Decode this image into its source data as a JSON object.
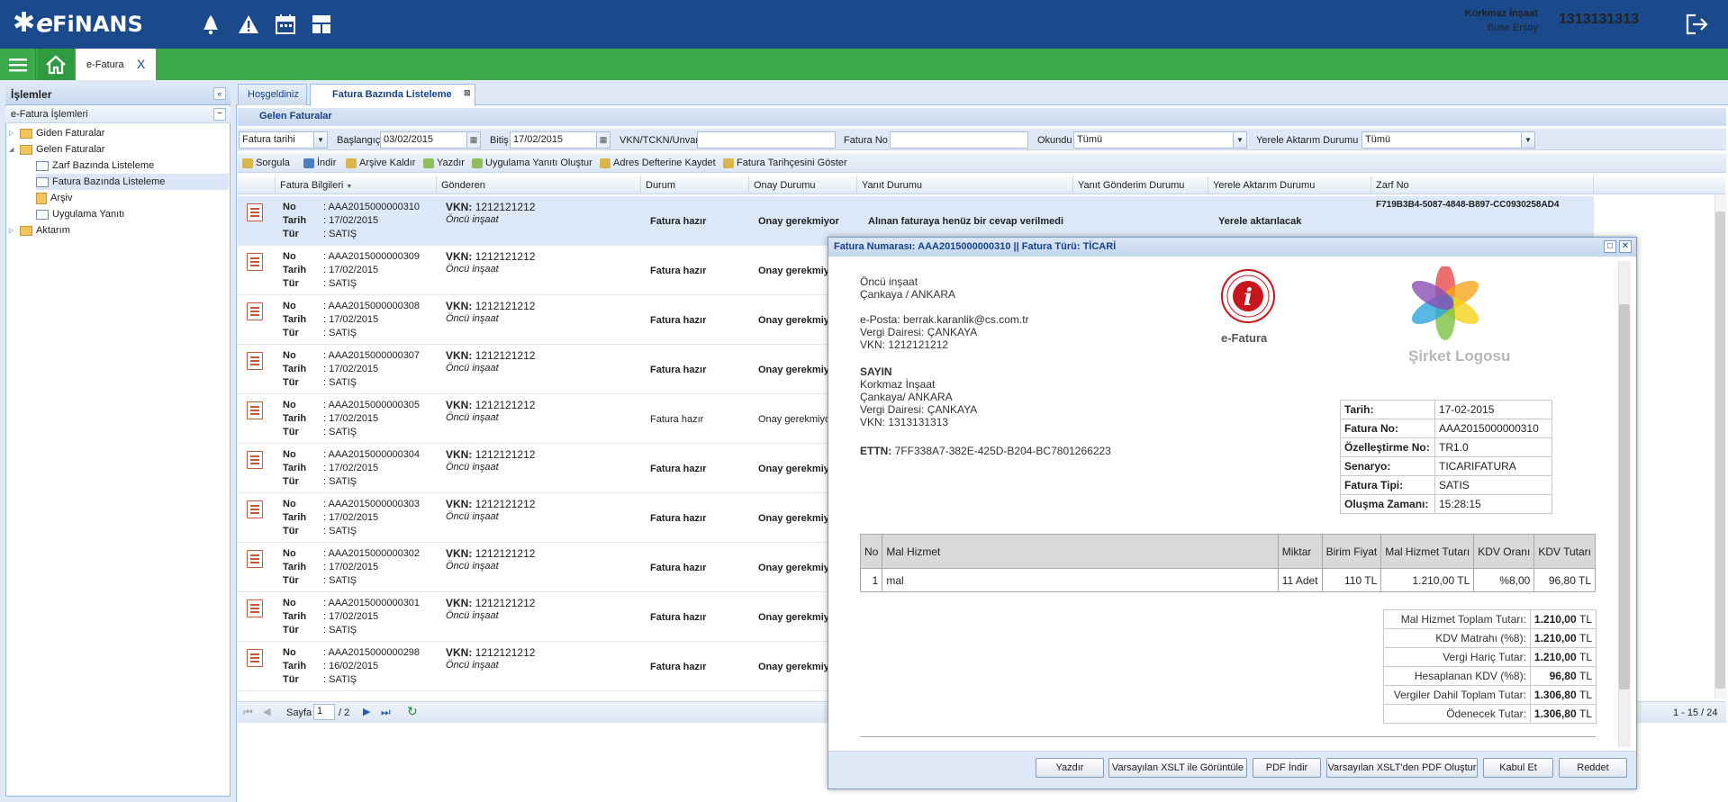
{
  "header": {
    "logo": {
      "star": "✱",
      "e": "e",
      "fin": "FiNANS"
    },
    "icons": [
      "bell-icon",
      "warning-icon",
      "calendar-icon",
      "dashboard-icon"
    ],
    "user_company": "Korkmaz İnşaat",
    "user_name": "Buse Ersoy",
    "user_vkn": "1313131313"
  },
  "nav": {
    "module_tab": "e-Fatura",
    "close_glyph": "X"
  },
  "left_panel": {
    "title": "İşlemler",
    "subtitle": "e-Fatura İşlemleri",
    "items": [
      {
        "label": "Giden Faturalar"
      },
      {
        "label": "Gelen Faturalar"
      },
      {
        "label": "Zarf Bazında Listeleme"
      },
      {
        "label": "Fatura Bazında Listeleme"
      },
      {
        "label": "Arşiv"
      },
      {
        "label": "Uygulama Yanıtı"
      },
      {
        "label": "Aktarım"
      }
    ]
  },
  "tabs": [
    {
      "label": "Hoşgeldiniz"
    },
    {
      "label": "Fatura Bazında Listeleme"
    }
  ],
  "section_title": "Gelen Faturalar",
  "filters": {
    "date_type": "Fatura tarihi",
    "start_label": "Başlangıç",
    "start_value": "03/02/2015",
    "end_label": "Bitiş",
    "end_value": "17/02/2015",
    "vkn_label": "VKN/TCKN/Unvan",
    "vkn_value": "",
    "fatura_no_label": "Fatura No",
    "fatura_no_value": "",
    "okundu_label": "Okundu",
    "okundu_value": "Tümü",
    "aktarim_label": "Yerele Aktarım Durumu",
    "aktarim_value": "Tümü"
  },
  "toolbar": {
    "sorgula": "Sorgula",
    "indir": "İndir",
    "arsive_kaldir": "Arşive Kaldır",
    "yazdir": "Yazdır",
    "uygulama_yaniti": "Uygulama Yanıtı Oluştur",
    "adres_defteri": "Adres Defterine Kaydet",
    "fatura_tarihcesi": "Fatura Tarihçesini Göster"
  },
  "grid": {
    "columns": [
      "Fatura Bilgileri",
      "Gönderen",
      "Durum",
      "Onay Durumu",
      "Yanıt Durumu",
      "Yanıt Gönderim Durumu",
      "Yerele Aktarım Durumu",
      "Zarf No"
    ],
    "key_no": "No",
    "key_tarih": "Tarih",
    "key_tur": "Tür",
    "vkn_key": "VKN:",
    "rows": [
      {
        "no": ": AAA2015000000310",
        "tarih": ": 17/02/2015",
        "tur": ": SATIŞ",
        "vkn": "1212121212",
        "sender": "Öncü inşaat",
        "durum": "Fatura hazır",
        "onay": "Onay gerekmiyor",
        "yanit": "Alınan faturaya henüz bir cevap verilmedi",
        "aktarim": "Yerele aktarılacak",
        "zarf": "F719B3B4-5087-4848-B897-CC0930258AD4"
      },
      {
        "no": ": AAA2015000000309",
        "tarih": ": 17/02/2015",
        "tur": ": SATIŞ",
        "vkn": "1212121212",
        "sender": "Öncü inşaat",
        "durum": "Fatura hazır",
        "onay": "Onay gerekmiy"
      },
      {
        "no": ": AAA2015000000308",
        "tarih": ": 17/02/2015",
        "tur": ": SATIŞ",
        "vkn": "1212121212",
        "sender": "Öncü inşaat",
        "durum": "Fatura hazır",
        "onay": "Onay gerekmiy"
      },
      {
        "no": ": AAA2015000000307",
        "tarih": ": 17/02/2015",
        "tur": ": SATIŞ",
        "vkn": "1212121212",
        "sender": "Öncü inşaat",
        "durum": "Fatura hazır",
        "onay": "Onay gerekmiy"
      },
      {
        "no": ": AAA2015000000305",
        "tarih": ": 17/02/2015",
        "tur": ": SATIŞ",
        "vkn": "1212121212",
        "sender": "Öncü inşaat",
        "durum": "Fatura hazır",
        "onay": "Onay gerekmiyo"
      },
      {
        "no": ": AAA2015000000304",
        "tarih": ": 17/02/2015",
        "tur": ": SATIŞ",
        "vkn": "1212121212",
        "sender": "Öncü inşaat",
        "durum": "Fatura hazır",
        "onay": "Onay gerekmiy"
      },
      {
        "no": ": AAA2015000000303",
        "tarih": ": 17/02/2015",
        "tur": ": SATIŞ",
        "vkn": "1212121212",
        "sender": "Öncü inşaat",
        "durum": "Fatura hazır",
        "onay": "Onay gerekmiy"
      },
      {
        "no": ": AAA2015000000302",
        "tarih": ": 17/02/2015",
        "tur": ": SATIŞ",
        "vkn": "1212121212",
        "sender": "Öncü inşaat",
        "durum": "Fatura hazır",
        "onay": "Onay gerekmiy"
      },
      {
        "no": ": AAA2015000000301",
        "tarih": ": 17/02/2015",
        "tur": ": SATIŞ",
        "vkn": "1212121212",
        "sender": "Öncü inşaat",
        "durum": "Fatura hazır",
        "onay": "Onay gerekmiy"
      },
      {
        "no": ": AAA2015000000298",
        "tarih": ": 16/02/2015",
        "tur": ": SATIŞ",
        "vkn": "1212121212",
        "sender": "Öncü inşaat",
        "durum": "Fatura hazır",
        "onay": "Onay gerekmiy"
      }
    ]
  },
  "pager": {
    "page_label": "Sayfa",
    "page_value": "1",
    "page_total": "/ 2",
    "range": "1 - 15 / 24"
  },
  "modal": {
    "title": "Fatura Numarası: AAA2015000000310 || Fatura Türü: TİCARİ",
    "seller": {
      "name": "Öncü inşaat",
      "address": "Çankaya / ANKARA",
      "email": "e-Posta: berrak.karanlik@cs.com.tr",
      "tax_office": "Vergi Dairesi: ÇANKAYA",
      "vkn": "VKN: 1212121212"
    },
    "buyer": {
      "heading": "SAYIN",
      "name": "Korkmaz İnşaat",
      "address": "Çankaya/ ANKARA",
      "tax_office": "Vergi Dairesi: ÇANKAYA",
      "vkn": "VKN: 1313131313"
    },
    "ettn_label": "ETTN:",
    "ettn_value": "7FF338A7-382E-425D-B204-BC7801266223",
    "efatura_logo_label": "e-Fatura",
    "company_logo_label": "Şirket Logosu",
    "info": [
      {
        "k": "Tarih:",
        "v": "17-02-2015"
      },
      {
        "k": "Fatura No:",
        "v": "AAA2015000000310"
      },
      {
        "k": "Özelleştirme No:",
        "v": "TR1.0"
      },
      {
        "k": "Senaryo:",
        "v": "TICARIFATURA"
      },
      {
        "k": "Fatura Tipi:",
        "v": "SATIS"
      },
      {
        "k": "Oluşma Zamanı:",
        "v": "15:28:15"
      }
    ],
    "lines_header": [
      "No",
      "Mal Hizmet",
      "Miktar",
      "Birim Fiyat",
      "Mal Hizmet Tutarı",
      "KDV Oranı",
      "KDV Tutarı"
    ],
    "lines": [
      {
        "no": "1",
        "item": "mal",
        "qty": "11 Adet",
        "price": "110 TL",
        "amount": "1.210,00 TL",
        "vat_rate": "%8,00",
        "vat": "96,80 TL"
      }
    ],
    "totals": [
      {
        "k": "Mal Hizmet Toplam Tutarı:",
        "v": "1.210,00",
        "c": "TL"
      },
      {
        "k": "KDV Matrahı (%8):",
        "v": "1.210,00",
        "c": "TL"
      },
      {
        "k": "Vergi Hariç Tutar:",
        "v": "1.210,00",
        "c": "TL"
      },
      {
        "k": "Hesaplanan KDV (%8):",
        "v": "96,80",
        "c": "TL"
      },
      {
        "k": "Vergiler Dahil Toplam Tutar:",
        "v": "1.306,80",
        "c": "TL"
      },
      {
        "k": "Ödenecek Tutar:",
        "v": "1.306,80",
        "c": "TL"
      }
    ],
    "buttons": {
      "yazdir": "Yazdır",
      "xslt_view": "Varsayılan XSLT ile Görüntüle",
      "pdf": "PDF İndir",
      "xslt_pdf": "Varsayılan XSLT'den PDF Oluştur",
      "kabul": "Kabul Et",
      "reddet": "Reddet"
    }
  },
  "colors": {
    "header_blue": "#1a4a8c",
    "nav_green": "#3aaa4a"
  }
}
